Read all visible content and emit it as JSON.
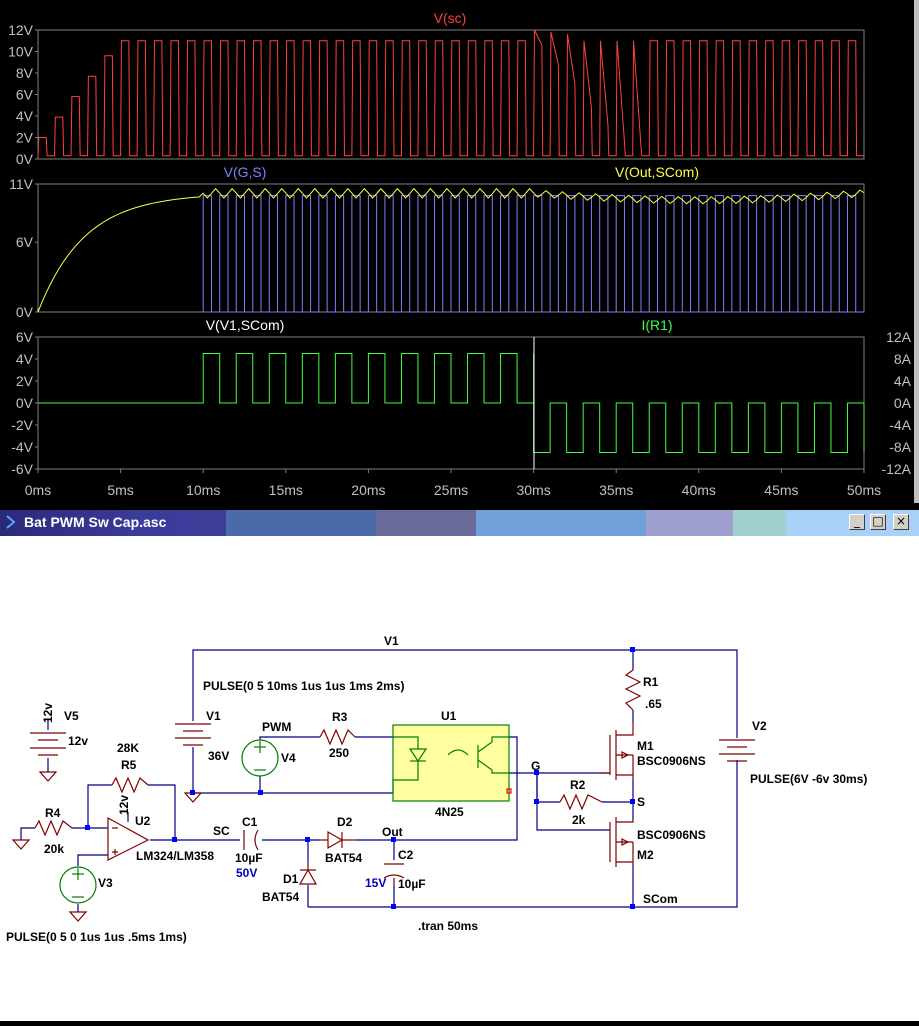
{
  "window": {
    "title": "Bat PWM Sw Cap.asc"
  },
  "chart_data": [
    {
      "type": "line",
      "title": "V(sc)",
      "series": [
        {
          "name": "V(sc)",
          "color": "#ff4040"
        }
      ],
      "y_ticks": [
        "12V",
        "10V",
        "8V",
        "6V",
        "4V",
        "2V",
        "0V"
      ],
      "ylim": [
        0,
        12
      ],
      "description_of_shape": "sawtooth-like square wave charging to ~11V, 1ms period, bump to ~12V at 30ms then settling"
    },
    {
      "type": "line",
      "series": [
        {
          "name": "V(G,S)",
          "color": "#8080ff"
        },
        {
          "name": "V(Out,SCom)",
          "color": "#ffff40"
        }
      ],
      "y_ticks": [
        "11V",
        "6V",
        "0V"
      ],
      "ylim": [
        0,
        11
      ]
    },
    {
      "type": "line",
      "series": [
        {
          "name": "V(V1,SCom)",
          "color": "#ffffff"
        },
        {
          "name": "I(R1)",
          "color": "#40ff40"
        }
      ],
      "y_ticks_left": [
        "6V",
        "4V",
        "2V",
        "0V",
        "-2V",
        "-4V",
        "-6V"
      ],
      "y_ticks_right": [
        "12A",
        "8A",
        "4A",
        "0A",
        "-4A",
        "-8A",
        "-12A"
      ],
      "ylim_left": [
        -6,
        6
      ],
      "ylim_right": [
        -12,
        12
      ],
      "x_ticks": [
        "0ms",
        "5ms",
        "10ms",
        "15ms",
        "20ms",
        "25ms",
        "30ms",
        "35ms",
        "40ms",
        "45ms",
        "50ms"
      ],
      "xlim": [
        0,
        50
      ]
    }
  ],
  "colors": {
    "grid": "#808080",
    "axis_text": "#c0c0c0",
    "wire": "#000080",
    "component": "#800000",
    "node": "#0000ff"
  },
  "schematic": {
    "labels": {
      "v1_net": "V1",
      "v1_pulse": "PULSE(0 5 10ms 1us 1us 1ms 2ms)",
      "v5_name": "V5",
      "v5_val": "12v",
      "v5_top": "12v",
      "v1_name": "V1",
      "v1_val": "36V",
      "pwm": "PWM",
      "v4": "V4",
      "r3": "R3",
      "r3_val": "250",
      "u1": "U1",
      "u1_part": "4N25",
      "r5_val": "28K",
      "r5": "R5",
      "u2_top": "12v",
      "u2": "U2",
      "u2_part": "LM324/LM358",
      "r4": "R4",
      "r4_val": "20k",
      "v3": "V3",
      "v3_pulse": "PULSE(0 5 0 1us 1us .5ms 1ms)",
      "sc": "SC",
      "c1": "C1",
      "c1_val": "10µF",
      "c1_v": "50V",
      "d2": "D2",
      "d2_part": "BAT54",
      "out": "Out",
      "c2": "C2",
      "c2_v": "15V",
      "c2_val": "10µF",
      "d1": "D1",
      "d1_part": "BAT54",
      "tran": ".tran 50ms",
      "g": "G",
      "r2": "R2",
      "r2_val": "2k",
      "s": "S",
      "r1": "R1",
      "r1_val": ".65",
      "m1": "M1",
      "m1_part": "BSC0906NS",
      "m2_part": "BSC0906NS",
      "m2": "M2",
      "scom": "SCom",
      "v2": "V2",
      "v2_pulse": "PULSE(6V -6v 30ms)"
    }
  }
}
